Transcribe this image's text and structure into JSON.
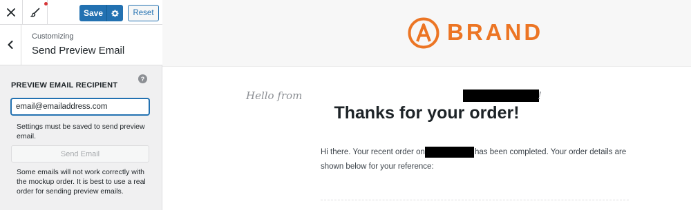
{
  "toolbar": {
    "save_label": "Save",
    "reset_label": "Reset"
  },
  "section": {
    "breadcrumb": "Customizing",
    "title": "Send Preview Email"
  },
  "form": {
    "field_label": "PREVIEW EMAIL RECIPIENT",
    "email_value": "email@emailaddress.com",
    "save_note": "Settings must be saved to send preview email.",
    "send_button": "Send Email",
    "warning": "Some emails will not work correctly with the mockup order. It is best to use a real order for sending preview emails."
  },
  "preview": {
    "brand_name": "BRAND",
    "brand_color": "#ec7524",
    "greeting": "Hello from",
    "greeting_end": "!",
    "heading": "Thanks for your order!",
    "body_line1_start": "Hi there. Your recent order on",
    "body_line1_end": "has been completed. Your order details are",
    "body_line2": "shown below for your reference:"
  },
  "colors": {
    "primary": "#2271b1",
    "notification": "#d63638"
  }
}
